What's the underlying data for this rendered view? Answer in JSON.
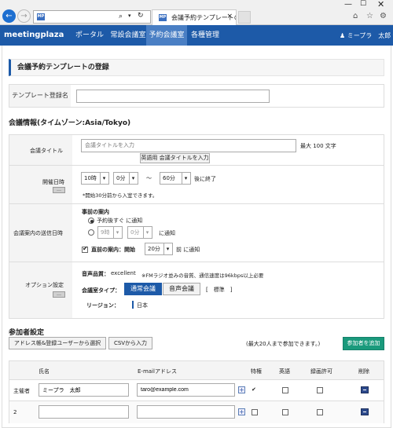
{
  "browser": {
    "tab_title": "会議予約テンプレートの登録",
    "search_icon": "search-icon",
    "refresh_icon": "refresh-icon",
    "window_controls": [
      "minimize",
      "maximize",
      "close"
    ]
  },
  "appbar": {
    "logo": "meetingplaza",
    "nav": [
      "ポータル",
      "常設会議室",
      "予約会議室",
      "各種管理"
    ],
    "active_nav": "予約会議室",
    "user": "ミープラ　太郎",
    "user_caret": "▾",
    "colors": {
      "bar": "#1d5aa8",
      "active": "#4a7fc4",
      "accent": "#1a9a7c"
    }
  },
  "page": {
    "title": "会議予約テンプレートの登録",
    "template_label": "テンプレート登録名",
    "template_value": ""
  },
  "meeting": {
    "heading": "会議情報(タイムゾーン:Asia/Tokyo)",
    "title_label": "会議タイトル",
    "title_placeholder": "会議タイトルを入力",
    "title_limit": "最大 100 文字",
    "english_title_button": "英語用 会議タイトルを入力",
    "datetime_label": "開催日時",
    "hour": "10時",
    "minute": "0分",
    "tilde": "～",
    "duration": "60分",
    "end_suffix": "後に終了",
    "entry_note": "*開始30分前から入室できます。",
    "notify_label": "会議案内の送信日時",
    "advance_title": "事前の案内",
    "option_immediate": "予約後すぐ に通知",
    "option_day": "9時",
    "option_min": "0分",
    "option_day_suffix": "に通知",
    "before_label": "直前の案内：開始",
    "before_value": "20分",
    "before_suffix": "前 に通知",
    "option_label": "オプション設定",
    "quality_label": "音声品質：",
    "quality_value": "excellent",
    "quality_note": "※FMラジオ並みの音質、通信速度は96kbps以上必要",
    "room_type_label": "会議室タイプ：",
    "room_type_normal": "通常会議",
    "room_type_audio": "音声会議",
    "room_standard": "[　標準　]",
    "region_label": "リージョン：",
    "region_value": "日本"
  },
  "participants": {
    "heading": "参加者設定",
    "btn_address": "アドレス帳&登録ユーザーから選択",
    "btn_csv": "CSVから入力",
    "limit_note": "(最大20人まで参加できます。)",
    "btn_add": "参加者を追加",
    "columns": [
      "氏名",
      "E-mailアドレス",
      "特権",
      "英語",
      "録画許可",
      "削除"
    ],
    "rows": [
      {
        "role": "主催者",
        "name": "ミープラ　太郎",
        "email": "taro@example.com",
        "privilege": "✔"
      },
      {
        "role": "2",
        "name": "",
        "email": "",
        "privilege": ""
      }
    ]
  }
}
